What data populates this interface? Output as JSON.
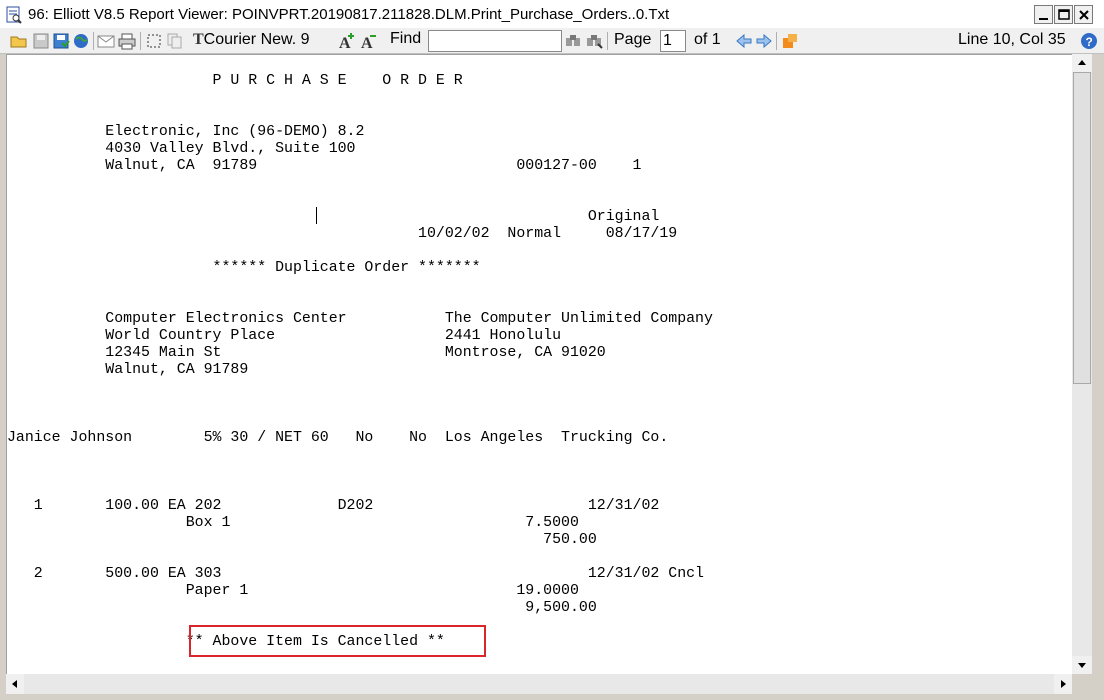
{
  "window": {
    "title": "96: Elliott V8.5 Report Viewer: POINVPRT.20190817.211828.DLM.Print_Purchase_Orders..0.Txt"
  },
  "toolbar": {
    "font_prefix": "T",
    "font_name": "Courier New. 9",
    "find_label": "Find",
    "find_value": "",
    "page_label": "Page",
    "page_value": "1",
    "of_label": "of 1",
    "status": "Line 10, Col 35"
  },
  "report": {
    "lines": [
      "                       P U R C H A S E    O R D E R",
      "",
      "",
      "           Electronic, Inc (96-DEMO) 8.2",
      "           4030 Valley Blvd., Suite 100",
      "           Walnut, CA  91789                             000127-00    1",
      "",
      "",
      "                                                                 Original",
      "                                              10/02/02  Normal     08/17/19",
      "",
      "                       ****** Duplicate Order *******",
      "",
      "",
      "           Computer Electronics Center           The Computer Unlimited Company",
      "           World Country Place                   2441 Honolulu",
      "           12345 Main St                         Montrose, CA 91020",
      "           Walnut, CA 91789",
      "",
      "",
      "",
      "Janice Johnson        5% 30 / NET 60   No    No  Los Angeles  Trucking Co.",
      "",
      "",
      "",
      "   1       100.00 EA 202             D202                        12/31/02",
      "                    Box 1                                 7.5000",
      "                                                            750.00",
      "",
      "   2       500.00 EA 303                                         12/31/02 Cncl",
      "                    Paper 1                              19.0000",
      "                                                          9,500.00",
      "",
      "                    ** Above Item Is Cancelled **"
    ]
  }
}
